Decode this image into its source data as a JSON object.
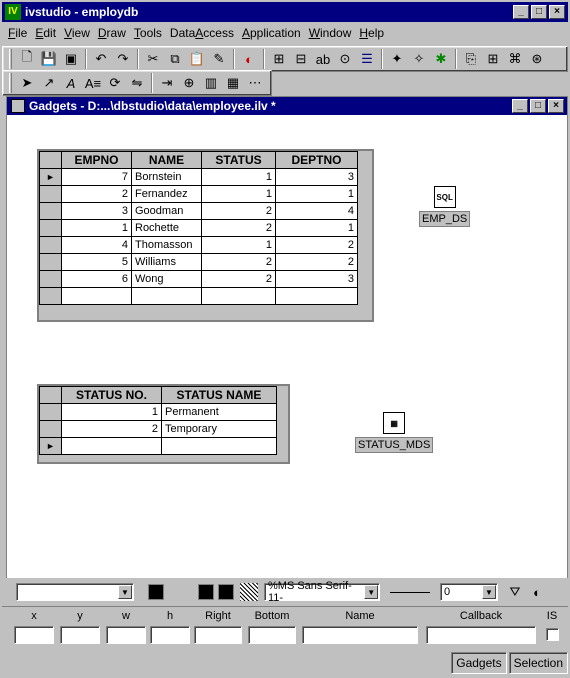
{
  "app": {
    "title": "ivstudio - employdb",
    "icon_text": "IV"
  },
  "menu": [
    "File",
    "Edit",
    "View",
    "Draw",
    "Tools",
    "DataAccess",
    "Application",
    "Window",
    "Help"
  ],
  "child": {
    "title": "Gadgets - D:...\\dbstudio\\data\\employee.ilv *"
  },
  "emp_table": {
    "columns": [
      "EMPNO",
      "NAME",
      "STATUS",
      "DEPTNO"
    ],
    "rows": [
      [
        "7",
        "Bornstein",
        "1",
        "3"
      ],
      [
        "2",
        "Fernandez",
        "1",
        "1"
      ],
      [
        "3",
        "Goodman",
        "2",
        "4"
      ],
      [
        "1",
        "Rochette",
        "2",
        "1"
      ],
      [
        "4",
        "Thomasson",
        "1",
        "2"
      ],
      [
        "5",
        "Williams",
        "2",
        "2"
      ],
      [
        "6",
        "Wong",
        "2",
        "3"
      ]
    ],
    "current_marker": "►"
  },
  "status_table": {
    "columns": [
      "STATUS NO.",
      "STATUS NAME"
    ],
    "rows": [
      [
        "1",
        "Permanent"
      ],
      [
        "2",
        "Temporary"
      ]
    ],
    "new_row_marker": "►"
  },
  "data_sources": {
    "emp": {
      "label": "EMP_DS",
      "icon_text": "SQL"
    },
    "status": {
      "label": "STATUS_MDS"
    }
  },
  "attrbar": {
    "font": "%MS Sans Serif-11-",
    "line_width": "0"
  },
  "inspector": {
    "labels": [
      "x",
      "y",
      "w",
      "h",
      "Right",
      "Bottom",
      "Name",
      "Callback",
      "IS"
    ]
  },
  "statusbar": [
    "Gadgets",
    "Selection"
  ]
}
